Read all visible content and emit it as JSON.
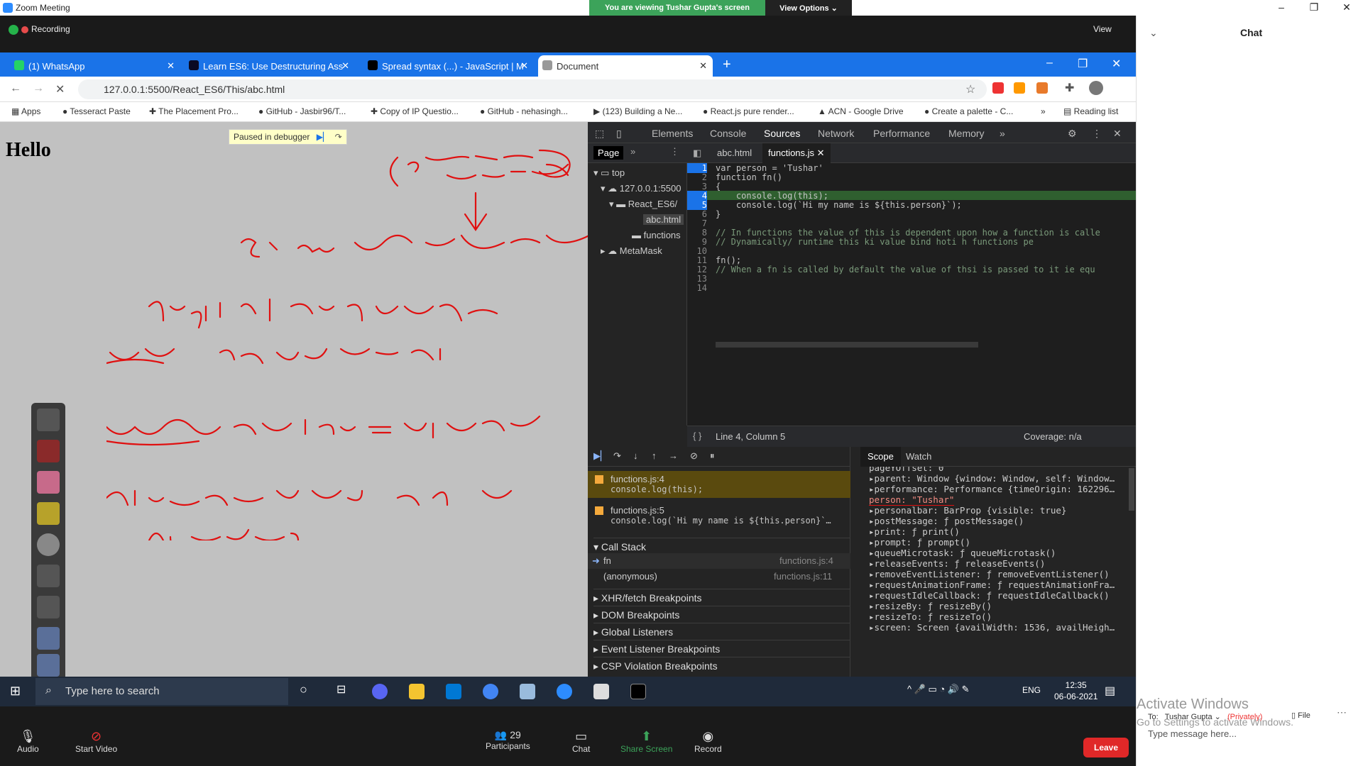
{
  "window": {
    "title": "Zoom Meeting"
  },
  "share": {
    "banner": "You are viewing Tushar Gupta's screen",
    "view_options": "View Options ⌄"
  },
  "meeting": {
    "recording": "Recording",
    "view": "View"
  },
  "browser": {
    "tabs": [
      {
        "label": "(1) WhatsApp"
      },
      {
        "label": "Learn ES6: Use Destructuring Ass"
      },
      {
        "label": "Spread syntax (...) - JavaScript | M"
      },
      {
        "label": "Document"
      }
    ],
    "url": "127.0.0.1:5500/React_ES6/This/abc.html",
    "bookmarks": [
      "Apps",
      "Tesseract Paste",
      "The Placement Pro...",
      "GitHub - Jasbir96/T...",
      "Copy of IP Questio...",
      "GitHub - nehasingh...",
      "(123) Building a Ne...",
      "React.js pure render...",
      "ACN - Google Drive",
      "Create a palette - C...",
      "»",
      "Reading list"
    ]
  },
  "page": {
    "heading": "Hello",
    "paused": "Paused in debugger"
  },
  "devtools": {
    "tabs": [
      "Elements",
      "Console",
      "Sources",
      "Network",
      "Performance",
      "Memory",
      "»"
    ],
    "nav_tab": "Page",
    "nav_items": [
      "top",
      "127.0.0.1:5500",
      "React_ES6/",
      "abc.html",
      "functions",
      "MetaMask"
    ],
    "editor_tabs": [
      "abc.html",
      "functions.js"
    ],
    "code": [
      "var person = 'Tushar'",
      "function fn()",
      "{",
      "    console.log(this);",
      "    console.log(`Hi my name is ${this.person}`);",
      "}",
      "",
      "// In functions the value of this is dependent upon how a function is calle",
      "// Dynamically/ runtime this ki value bind hoti h functions pe",
      "",
      "fn();",
      "// When a fn is called by default the value of thsi is passed to it ie equ",
      "",
      ""
    ],
    "line_numbers": [
      "1",
      "2",
      "3",
      "4",
      "5",
      "6",
      "7",
      "8",
      "9",
      "10",
      "11",
      "12",
      "13",
      "14"
    ],
    "status": "Line 4, Column 5",
    "coverage": "Coverage: n/a",
    "breakpoints": [
      {
        "file": "functions.js:4",
        "code": "console.log(this);"
      },
      {
        "file": "functions.js:5",
        "code": "console.log(`Hi my name is ${this.person}`…"
      }
    ],
    "call_stack_title": "Call Stack",
    "call_stack": [
      {
        "name": "fn",
        "loc": "functions.js:4"
      },
      {
        "name": "(anonymous)",
        "loc": "functions.js:11"
      }
    ],
    "sections": [
      "XHR/fetch Breakpoints",
      "DOM Breakpoints",
      "Global Listeners",
      "Event Listener Breakpoints",
      "CSP Violation Breakpoints"
    ],
    "scope_tabs": [
      "Scope",
      "Watch"
    ],
    "scope": [
      "pageYOffset: 0",
      "▸parent: Window {window: Window, self: Window…",
      "▸performance: Performance {timeOrigin: 162296…",
      " person: \"Tushar\"",
      "▸personalbar: BarProp {visible: true}",
      "▸postMessage: ƒ postMessage()",
      "▸print: ƒ print()",
      "▸prompt: ƒ prompt()",
      "▸queueMicrotask: ƒ queueMicrotask()",
      "▸releaseEvents: ƒ releaseEvents()",
      "▸removeEventListener: ƒ removeEventListener()",
      "▸requestAnimationFrame: ƒ requestAnimationFra…",
      "▸requestIdleCallback: ƒ requestIdleCallback()",
      "▸resizeBy: ƒ resizeBy()",
      "▸resizeTo: ƒ resizeTo()",
      "▸screen: Screen {availWidth: 1536, availHeigh…"
    ]
  },
  "taskbar": {
    "search": "Type here to search",
    "lang": "ENG",
    "time": "12:35",
    "date": "06-06-2021"
  },
  "zoom_controls": {
    "audio": "Audio",
    "video": "Start Video",
    "participants": "Participants",
    "participants_count": "29",
    "chat": "Chat",
    "share": "Share Screen",
    "record": "Record",
    "leave": "Leave"
  },
  "chat": {
    "title": "Chat",
    "to_label": "To:",
    "to": "Tushar Gupta ⌄",
    "privately": "(Privately)",
    "file": "File",
    "placeholder": "Type message here...",
    "activate1": "Activate Windows",
    "activate2": "Go to Settings to activate Windows."
  }
}
